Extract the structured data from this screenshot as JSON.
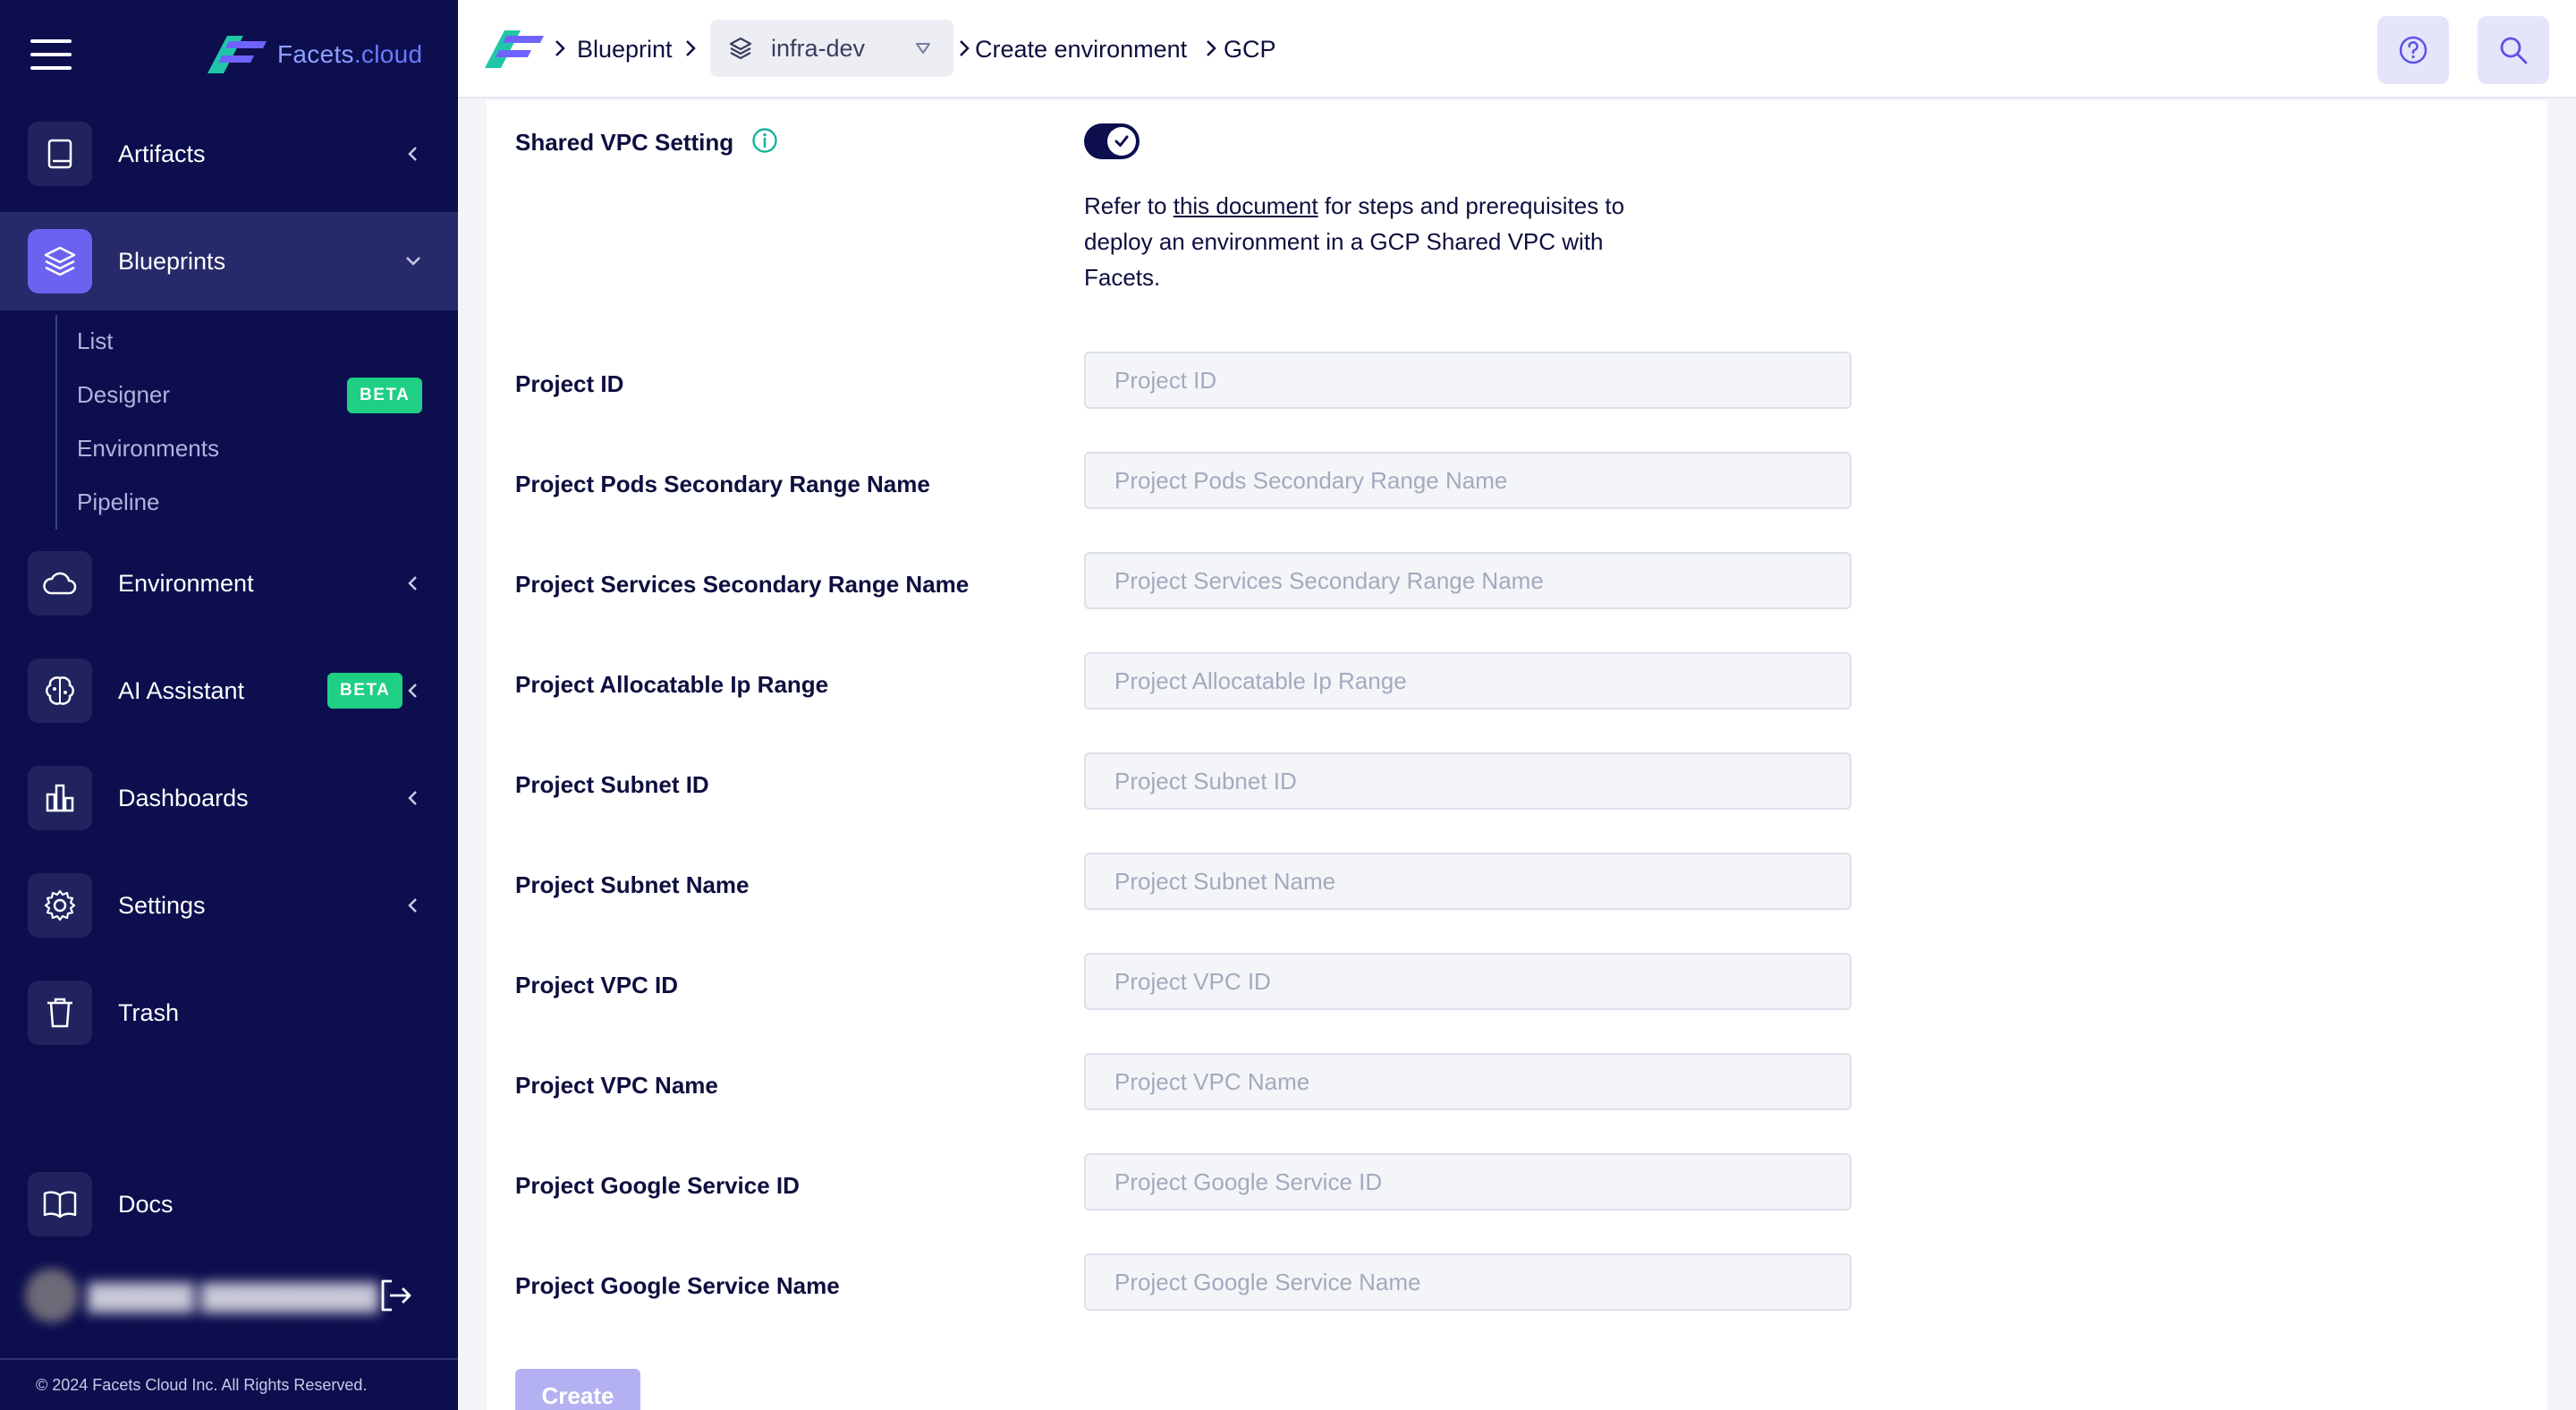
{
  "sidebar": {
    "logo_text_main": "Facets",
    "logo_text_suffix": ".cloud",
    "items": [
      {
        "label": "Artifacts",
        "icon": "book-icon"
      },
      {
        "label": "Blueprints",
        "icon": "layers-icon"
      },
      {
        "label": "Environment",
        "icon": "cloud-icon"
      },
      {
        "label": "AI Assistant",
        "icon": "brain-icon",
        "badge": "BETA"
      },
      {
        "label": "Dashboards",
        "icon": "bar-chart-icon"
      },
      {
        "label": "Settings",
        "icon": "gear-icon"
      },
      {
        "label": "Trash",
        "icon": "trash-icon"
      },
      {
        "label": "Docs",
        "icon": "open-book-icon"
      }
    ],
    "blueprint_subitems": [
      {
        "label": "List"
      },
      {
        "label": "Designer",
        "badge": "BETA"
      },
      {
        "label": "Environments"
      },
      {
        "label": "Pipeline"
      }
    ],
    "footer": "© 2024 Facets Cloud Inc. All Rights Reserved."
  },
  "header": {
    "breadcrumb": {
      "blueprint": "Blueprint",
      "selected_blueprint": "infra-dev",
      "create_environment": "Create environment",
      "provider": "GCP"
    }
  },
  "form": {
    "shared_vpc_label": "Shared VPC Setting",
    "shared_vpc_enabled": true,
    "note_prefix": "Refer to ",
    "note_link": "this document",
    "note_suffix": " for steps and prerequisites to deploy an environment in a GCP Shared VPC with Facets.",
    "fields": [
      {
        "label": "Project ID",
        "placeholder": "Project ID",
        "value": ""
      },
      {
        "label": "Project Pods Secondary Range Name",
        "placeholder": "Project Pods Secondary Range Name",
        "value": ""
      },
      {
        "label": "Project Services Secondary Range Name",
        "placeholder": "Project Services Secondary Range Name",
        "value": ""
      },
      {
        "label": "Project Allocatable Ip Range",
        "placeholder": "Project Allocatable Ip Range",
        "value": ""
      },
      {
        "label": "Project Subnet ID",
        "placeholder": "Project Subnet ID",
        "value": ""
      },
      {
        "label": "Project Subnet Name",
        "placeholder": "Project Subnet Name",
        "value": ""
      },
      {
        "label": "Project VPC ID",
        "placeholder": "Project VPC ID",
        "value": ""
      },
      {
        "label": "Project VPC Name",
        "placeholder": "Project VPC Name",
        "value": ""
      },
      {
        "label": "Project Google Service ID",
        "placeholder": "Project Google Service ID",
        "value": ""
      },
      {
        "label": "Project Google Service Name",
        "placeholder": "Project Google Service Name",
        "value": ""
      }
    ],
    "create_label": "Create"
  },
  "colors": {
    "sidebar_bg": "#0c0e4e",
    "active_item_bg": "#26296a",
    "accent": "#6b62f0",
    "badge": "#1ecf84",
    "create_button": "#b4b1f3"
  }
}
